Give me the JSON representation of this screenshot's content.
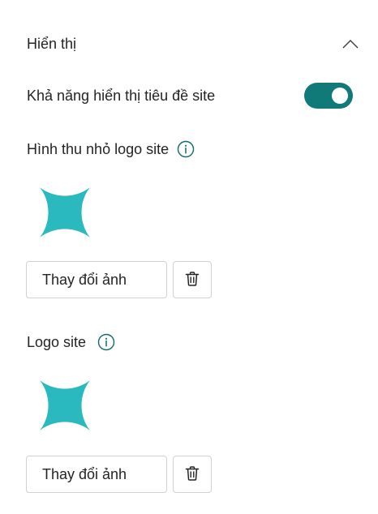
{
  "section": {
    "title": "Hiển thị",
    "chevron_icon": "chevron-up-icon"
  },
  "site_title_visibility": {
    "label": "Khả năng hiển thị tiêu đề site",
    "toggle_on": true,
    "accent": "#0f7a78"
  },
  "logo_thumbnail": {
    "label": "Hình thu nhỏ logo site",
    "info_icon": "info-icon",
    "logo_icon": "four-point-star-icon",
    "logo_color": "#29b9bf",
    "change_label": "Thay đổi ảnh",
    "delete_icon": "trash-icon"
  },
  "site_logo": {
    "label": "Logo site",
    "info_icon": "info-icon",
    "logo_icon": "four-point-star-icon",
    "logo_color": "#29b9bf",
    "change_label": "Thay đổi ảnh",
    "delete_icon": "trash-icon"
  }
}
